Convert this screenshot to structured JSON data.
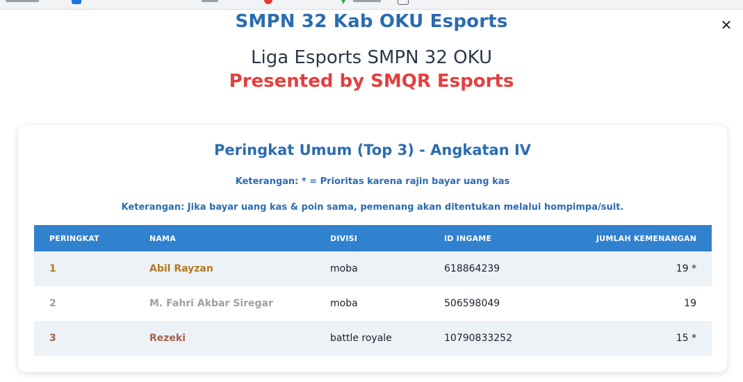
{
  "header": {
    "site_title": "SMPN 32 Kab OKU Esports",
    "league_title": "Liga Esports SMPN 32 OKU",
    "presented_by": "Presented by SMQR Esports",
    "close_label": "✕"
  },
  "ranking": {
    "title": "Peringkat Umum (Top 3) - Angkatan IV",
    "note_priority": "Keterangan: * = Prioritas karena rajin bayar uang kas",
    "note_tiebreak": "Keterangan: Jika bayar uang kas & poin sama, pemenang akan ditentukan melalui hompimpa/suit.",
    "columns": {
      "rank": "PERINGKAT",
      "name": "NAMA",
      "division": "DIVISI",
      "ingame_id": "ID INGAME",
      "wins": "JUMLAH KEMENANGAN"
    },
    "rows": [
      {
        "rank": "1",
        "name": "Abil Rayzan",
        "division": "moba",
        "ingame_id": "618864239",
        "wins": "19 *"
      },
      {
        "rank": "2",
        "name": "M. Fahri Akbar Siregar",
        "division": "moba",
        "ingame_id": "506598049",
        "wins": "19"
      },
      {
        "rank": "3",
        "name": "Rezeki",
        "division": "battle royale",
        "ingame_id": "10790833252",
        "wins": "15 *"
      }
    ]
  },
  "colors": {
    "primary_blue": "#2b6cb0",
    "header_blue": "#3182ce",
    "accent_red": "#e53e3e",
    "gold": "#b7791f",
    "silver": "#a0a0a0",
    "bronze": "#a0634a",
    "row_stripe": "#edf2f7"
  }
}
